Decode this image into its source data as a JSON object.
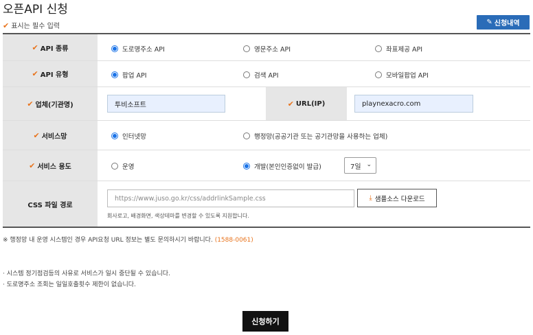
{
  "page": {
    "title": "오픈API 신청",
    "required_note": "표시는 필수 입력",
    "history_button": "신청내역"
  },
  "form": {
    "api_type": {
      "label": "API 종류",
      "options": [
        "도로명주소 API",
        "영문주소 API",
        "좌표제공 API"
      ],
      "selected": 0
    },
    "api_kind": {
      "label": "API 유형",
      "options": [
        "팝업 API",
        "검색 API",
        "모바일팝업 API"
      ],
      "selected": 0
    },
    "company": {
      "label": "업체(기관명)",
      "value": "투비소프트"
    },
    "url": {
      "label": "URL(IP)",
      "value": "playnexacro.com"
    },
    "service_net": {
      "label": "서비스망",
      "options": [
        "인터넷망",
        "행정망(공공기관 또는 공기관망을 사용하는 업체)"
      ],
      "selected": 0
    },
    "usage": {
      "label": "서비스 용도",
      "options": [
        "운영",
        "개발(본인인증없이 발급)"
      ],
      "selected": 1,
      "period": "7일"
    },
    "css_path": {
      "label": "CSS 파일 경로",
      "placeholder": "https://www.juso.go.kr/css/addrlinkSample.css",
      "download_button": "샘플소스 다운로드",
      "help": "회사로고, 배경화면, 색상테마를 변경할 수 있도록 지원합니다."
    }
  },
  "notice": {
    "text": "※ 행정망 내 운영 시스템인 경우 API요청 URL 정보는 별도 문의하시기 바랍니다.",
    "phone": "(1588-0061)"
  },
  "bullets": [
    "· 시스템 정기점검등의 사유로 서비스가 일시 중단될 수 있습니다.",
    "· 도로명주소 조회는 일일호출횟수 제한이 없습니다."
  ],
  "submit_button": "신청하기",
  "colors": {
    "accent": "#2a6cb8",
    "check": "#e8731c",
    "radio": "#1a73e8"
  }
}
